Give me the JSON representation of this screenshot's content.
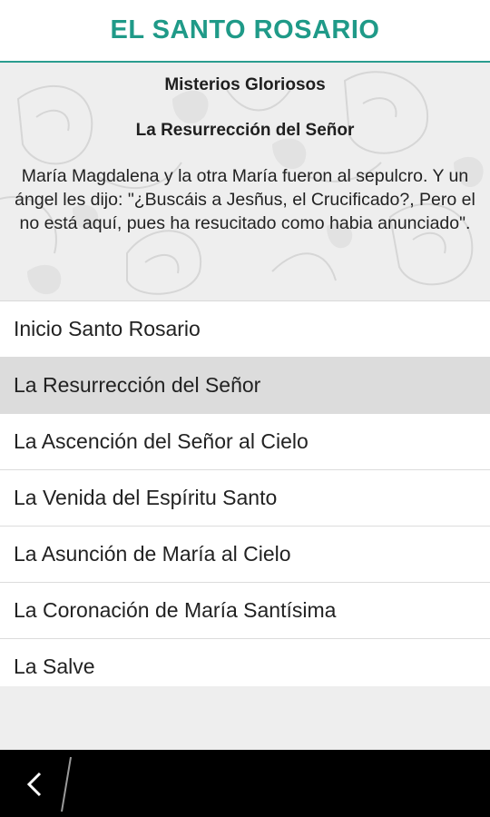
{
  "app": {
    "title": "EL SANTO ROSARIO"
  },
  "mystery": {
    "group": "Misterios Gloriosos",
    "title": "La Resurrección del Señor",
    "text": "María Magdalena y la otra María fueron al sepulcro. Y un ángel les dijo: \"¿Buscáis a Jesñus, el Crucificado?, Pero el no está aquí, pues ha resucitado como habia anunciado\"."
  },
  "menu": {
    "items": [
      {
        "label": "Inicio Santo Rosario"
      },
      {
        "label": "La Resurrección del Señor"
      },
      {
        "label": "La Ascención del Señor al Cielo"
      },
      {
        "label": "La Venida del Espíritu Santo"
      },
      {
        "label": "La Asunción de María al Cielo"
      },
      {
        "label": "La Coronación de María Santísima"
      },
      {
        "label": "La Salve"
      }
    ],
    "selected_item": "La Resurrección del Señor"
  },
  "colors": {
    "accent": "#1f9a88",
    "selected_row": "#dcdcdc",
    "hero_background": "#eeeeee",
    "nav_bar": "#000000"
  },
  "icons": {
    "back": "back-chevron-icon",
    "background": "roses-pattern"
  }
}
